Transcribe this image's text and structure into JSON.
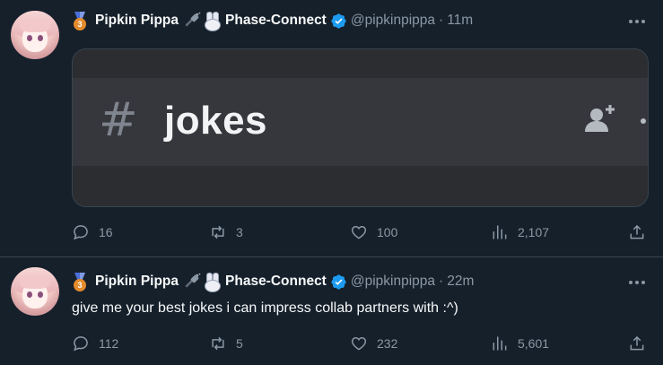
{
  "tweets": [
    {
      "name": "Pipkin Pippa",
      "org": "Phase-Connect",
      "handle": "@pipkinpippa",
      "separator": "·",
      "time": "11m",
      "medal_text": "3",
      "media_channel": "jokes",
      "stats": {
        "replies": "16",
        "retweets": "3",
        "likes": "100",
        "views": "2,107"
      }
    },
    {
      "name": "Pipkin Pippa",
      "org": "Phase-Connect",
      "handle": "@pipkinpippa",
      "separator": "·",
      "time": "22m",
      "medal_text": "3",
      "text": "give me your best jokes i can impress collab partners with :^)",
      "stats": {
        "replies": "112",
        "retweets": "5",
        "likes": "232",
        "views": "5,601"
      }
    }
  ],
  "colors": {
    "background": "#15202b",
    "muted": "#8b98a5",
    "verified": "#1d9bf0",
    "divider": "#38444d"
  },
  "icons": [
    "medal-icon",
    "plug-icon",
    "bunny-icon",
    "verified-badge-icon",
    "more-icon",
    "reply-icon",
    "retweet-icon",
    "like-icon",
    "views-icon",
    "share-icon",
    "hash-icon",
    "add-user-icon"
  ]
}
